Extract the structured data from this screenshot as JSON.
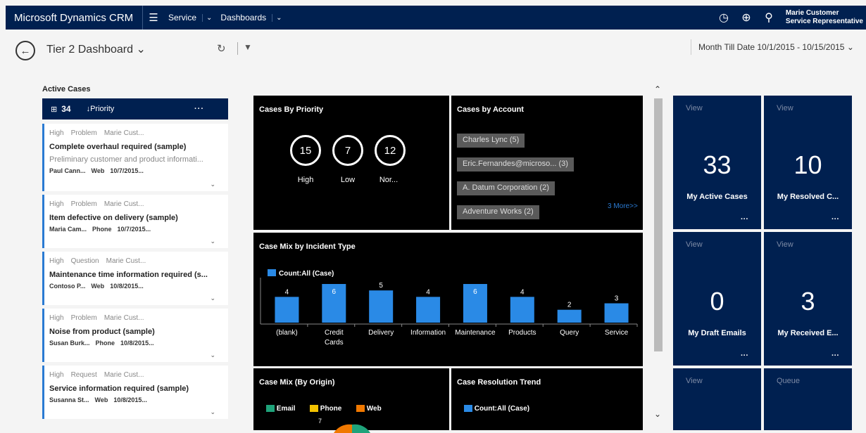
{
  "app": {
    "brand": "Microsoft Dynamics CRM",
    "nav": [
      {
        "label": "Service"
      },
      {
        "label": "Dashboards"
      }
    ],
    "user_name": "Marie Customer",
    "user_role": "Service Representative"
  },
  "command_bar": {
    "dashboard_title": "Tier 2 Dashboard",
    "date_range": "Month Till Date 10/1/2015 - 10/15/2015"
  },
  "active_cases": {
    "title": "Active Cases",
    "count": "34",
    "sort_label": "↓Priority",
    "more": "···",
    "items": [
      {
        "priority": "High",
        "type": "Problem",
        "owner": "Marie Cust...",
        "title": "Complete overhaul required (sample)",
        "description": "Preliminary customer and product informati...",
        "customer": "Paul Cann...",
        "origin": "Web",
        "date": "10/7/2015..."
      },
      {
        "priority": "High",
        "type": "Problem",
        "owner": "Marie Cust...",
        "title": "Item defective on delivery (sample)",
        "description": "",
        "customer": "Maria Cam...",
        "origin": "Phone",
        "date": "10/7/2015..."
      },
      {
        "priority": "High",
        "type": "Question",
        "owner": "Marie Cust...",
        "title": "Maintenance time information required (s...",
        "description": "",
        "customer": "Contoso P...",
        "origin": "Web",
        "date": "10/8/2015..."
      },
      {
        "priority": "High",
        "type": "Problem",
        "owner": "Marie Cust...",
        "title": "Noise from product (sample)",
        "description": "",
        "customer": "Susan Burk...",
        "origin": "Phone",
        "date": "10/8/2015..."
      },
      {
        "priority": "High",
        "type": "Request",
        "owner": "Marie Cust...",
        "title": "Service information required (sample)",
        "description": "",
        "customer": "Susanna St...",
        "origin": "Web",
        "date": "10/8/2015..."
      }
    ]
  },
  "cases_by_priority": {
    "title": "Cases By Priority",
    "items": [
      {
        "value": "15",
        "label": "High"
      },
      {
        "value": "7",
        "label": "Low"
      },
      {
        "value": "12",
        "label": "Nor..."
      }
    ]
  },
  "cases_by_account": {
    "title": "Cases by Account",
    "items": [
      "Charles Lync (5)",
      "Eric.Fernandes@microso... (3)",
      "A. Datum Corporation (2)",
      "Adventure Works (2)"
    ],
    "more": "3 More>>"
  },
  "chart_data": [
    {
      "type": "bar",
      "title": "Case Mix by Incident Type",
      "categories": [
        "(blank)",
        "Credit Cards",
        "Delivery",
        "Information",
        "Maintenance",
        "Products",
        "Query",
        "Service"
      ],
      "series": [
        {
          "name": "Count:All (Case)",
          "values": [
            4,
            6,
            5,
            4,
            6,
            4,
            2,
            3
          ]
        }
      ],
      "color": "#2a8ae6"
    }
  ],
  "case_mix_origin": {
    "title": "Case Mix (By Origin)",
    "legend": [
      {
        "name": "Email",
        "color": "#1fa37a"
      },
      {
        "name": "Phone",
        "color": "#f2c200"
      },
      {
        "name": "Web",
        "color": "#f07800"
      }
    ],
    "visible_label": "7"
  },
  "case_resolution_trend": {
    "title": "Case Resolution Trend",
    "legend": "Count:All (Case)"
  },
  "tiles": [
    {
      "link": "View",
      "value": "33",
      "name": "My Active Cases",
      "more": "···"
    },
    {
      "link": "View",
      "value": "10",
      "name": "My Resolved C...",
      "more": "···"
    },
    {
      "link": "View",
      "value": "0",
      "name": "My Draft Emails",
      "more": "···"
    },
    {
      "link": "View",
      "value": "3",
      "name": "My Received E...",
      "more": "···"
    },
    {
      "link": "View"
    },
    {
      "link": "Queue"
    }
  ]
}
